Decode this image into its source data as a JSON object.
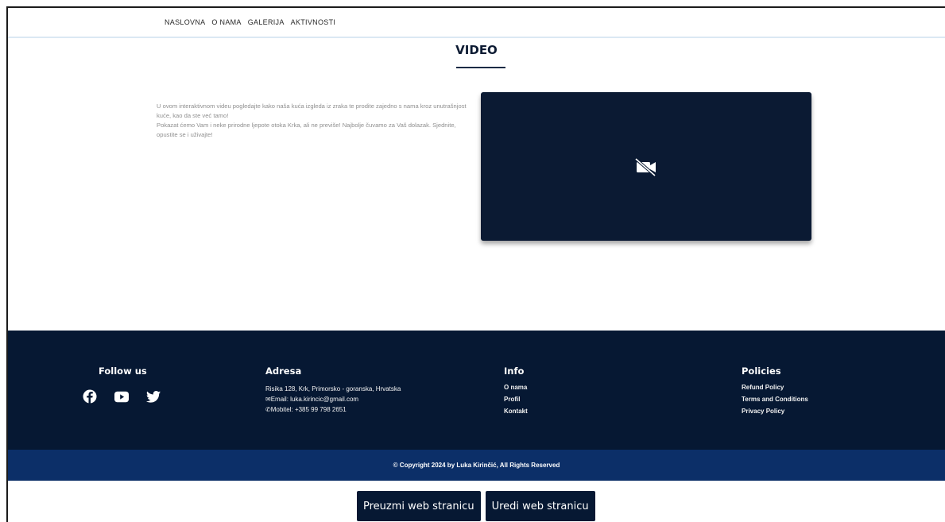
{
  "nav": {
    "links": [
      "NASLOVNA",
      "O NAMA",
      "GALERIJA",
      "AKTIVNOSTI"
    ]
  },
  "section": {
    "title": "VIDEO",
    "paragraph1": "U ovom interaktivnom videu pogledajte kako naša kuća izgleda iz zraka te prodite zajedno s nama kroz unutrašnjost kuće, kao da ste već tamo!",
    "paragraph2": "Pokazat ćemo Vam i neke prirodne ljepote otoka Krka, ali ne previše! Najbolje čuvamo za Vaš dolazak. Sjednite, opustite se i uživajte!"
  },
  "video": {
    "icon": "video-off-icon"
  },
  "footer": {
    "follow": {
      "heading": "Follow us",
      "icons": [
        "facebook-icon",
        "youtube-icon",
        "twitter-icon"
      ]
    },
    "address": {
      "heading": "Adresa",
      "line1": "Risika 128, Krk, Primorsko - goranska, Hrvatska",
      "email": "Email: luka.kirincic@gmail.com",
      "phone": "Mobitel: +385 99 798 2651"
    },
    "info": {
      "heading": "Info",
      "links": [
        "O nama",
        "Profil",
        "Kontakt"
      ]
    },
    "policies": {
      "heading": "Policies",
      "links": [
        "Refund Policy",
        "Terms and Conditions",
        "Privacy Policy"
      ]
    },
    "copyright": "© Copyright 2024 by Luka Kirinčić, All Rights Reserved"
  },
  "actions": {
    "download_label": "Preuzmi web stranicu",
    "edit_label": "Uredi web stranicu"
  },
  "colors": {
    "navy": "#061833",
    "copyright_bar": "#0c2f68",
    "video_bg": "#0b1a33"
  }
}
